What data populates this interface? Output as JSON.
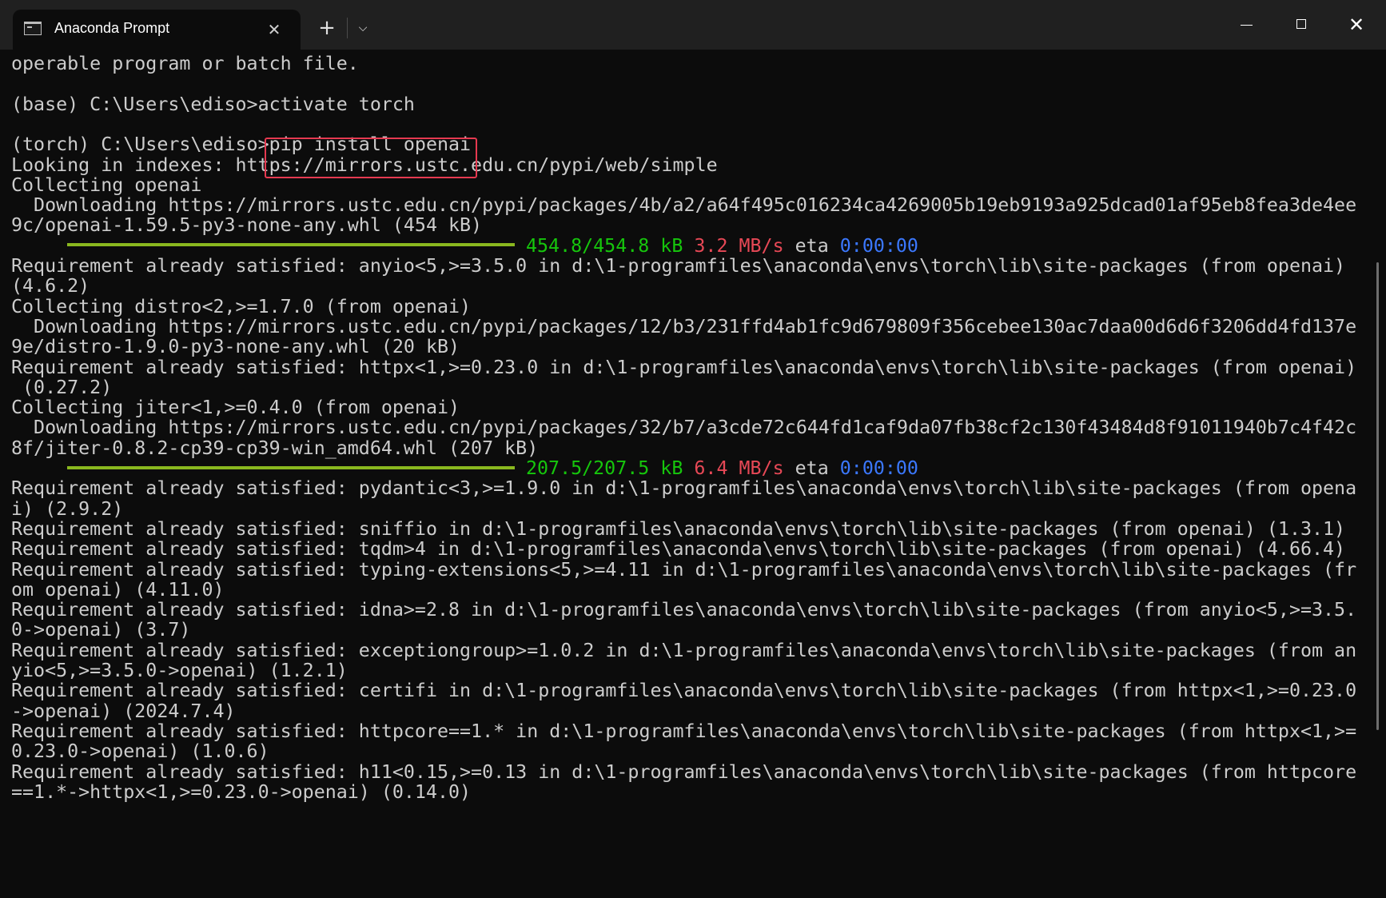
{
  "window": {
    "tab_title": "Anaconda Prompt",
    "tab_close": "✕",
    "new_tab": "+",
    "dropdown": "⌵",
    "close": "✕",
    "icons": {
      "tab": "terminal-icon",
      "minimize": "minimize-icon",
      "maximize": "maximize-icon",
      "close": "close-icon"
    }
  },
  "console": {
    "colors": {
      "foreground": "#cccccc",
      "background": "#0c0c0c",
      "progress_bar": "#8ab81f",
      "green": "#16c60c",
      "red": "#e74856",
      "blue": "#3b78ff",
      "highlight": "#e53950"
    },
    "lines": [
      "operable program or batch file.",
      "",
      "(base) C:\\Users\\ediso>activate torch",
      "",
      "(torch) C:\\Users\\ediso>pip install openai",
      "Looking in indexes: https://mirrors.ustc.edu.cn/pypi/web/simple",
      "Collecting openai",
      "  Downloading https://mirrors.ustc.edu.cn/pypi/packages/4b/a2/a64f495c016234ca4269005b19eb9193a925dcad01af95eb8fea3de4ee",
      "9c/openai-1.59.5-py3-none-any.whl (454 kB)",
      "",
      "Requirement already satisfied: anyio<5,>=3.5.0 in d:\\1-programfiles\\anaconda\\envs\\torch\\lib\\site-packages (from openai)",
      "(4.6.2)",
      "Collecting distro<2,>=1.7.0 (from openai)",
      "  Downloading https://mirrors.ustc.edu.cn/pypi/packages/12/b3/231ffd4ab1fc9d679809f356cebee130ac7daa00d6d6f3206dd4fd137e",
      "9e/distro-1.9.0-py3-none-any.whl (20 kB)",
      "Requirement already satisfied: httpx<1,>=0.23.0 in d:\\1-programfiles\\anaconda\\envs\\torch\\lib\\site-packages (from openai)",
      " (0.27.2)",
      "Collecting jiter<1,>=0.4.0 (from openai)",
      "  Downloading https://mirrors.ustc.edu.cn/pypi/packages/32/b7/a3cde72c644fd1caf9da07fb38cf2c130f43484d8f91011940b7c4f42c",
      "8f/jiter-0.8.2-cp39-cp39-win_amd64.whl (207 kB)",
      "",
      "Requirement already satisfied: pydantic<3,>=1.9.0 in d:\\1-programfiles\\anaconda\\envs\\torch\\lib\\site-packages (from opena",
      "i) (2.9.2)",
      "Requirement already satisfied: sniffio in d:\\1-programfiles\\anaconda\\envs\\torch\\lib\\site-packages (from openai) (1.3.1)",
      "Requirement already satisfied: tqdm>4 in d:\\1-programfiles\\anaconda\\envs\\torch\\lib\\site-packages (from openai) (4.66.4)",
      "Requirement already satisfied: typing-extensions<5,>=4.11 in d:\\1-programfiles\\anaconda\\envs\\torch\\lib\\site-packages (fr",
      "om openai) (4.11.0)",
      "Requirement already satisfied: idna>=2.8 in d:\\1-programfiles\\anaconda\\envs\\torch\\lib\\site-packages (from anyio<5,>=3.5.",
      "0->openai) (3.7)",
      "Requirement already satisfied: exceptiongroup>=1.0.2 in d:\\1-programfiles\\anaconda\\envs\\torch\\lib\\site-packages (from an",
      "yio<5,>=3.5.0->openai) (1.2.1)",
      "Requirement already satisfied: certifi in d:\\1-programfiles\\anaconda\\envs\\torch\\lib\\site-packages (from httpx<1,>=0.23.0",
      "->openai) (2024.7.4)",
      "Requirement already satisfied: httpcore==1.* in d:\\1-programfiles\\anaconda\\envs\\torch\\lib\\site-packages (from httpx<1,>=",
      "0.23.0->openai) (1.0.6)",
      "Requirement already satisfied: h11<0.15,>=0.13 in d:\\1-programfiles\\anaconda\\envs\\torch\\lib\\site-packages (from httpcore",
      "==1.*->httpx<1,>=0.23.0->openai) (0.14.0)"
    ],
    "progress": [
      {
        "line_index": 9,
        "fraction": 1.0,
        "size": "454.8/454.8 kB",
        "speed": "3.2 MB/s",
        "eta_label": "eta",
        "eta": "0:00:00"
      },
      {
        "line_index": 20,
        "fraction": 1.0,
        "size": "207.5/207.5 kB",
        "speed": "6.4 MB/s",
        "eta_label": "eta",
        "eta": "0:00:00"
      }
    ]
  }
}
